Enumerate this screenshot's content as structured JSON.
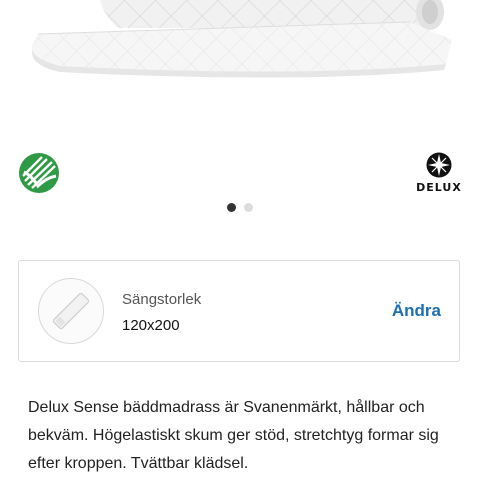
{
  "product": {
    "image_name": "mattress-topper-image",
    "description": "Delux Sense bäddmadrass är Svanenmärkt, hållbar och bekväm. Högelastiskt skum ger stöd, stretchtyg formar sig efter kroppen. Tvättbar klädsel."
  },
  "badges": {
    "ecolabel_icon": "nordic-swan-ecolabel-icon",
    "brand_logo_icon": "delux-star-icon",
    "brand_logo_text": "DELUX"
  },
  "carousel": {
    "total": 2,
    "active_index": 0
  },
  "size_selector": {
    "icon": "bed-size-icon",
    "label": "Sängstorlek",
    "value": "120x200",
    "change_label": "Ändra"
  },
  "colors": {
    "link": "#1b6fb2",
    "ecolabel_green": "#2f9a45",
    "dot_active": "#333333",
    "dot_inactive": "#dcdcdc"
  }
}
